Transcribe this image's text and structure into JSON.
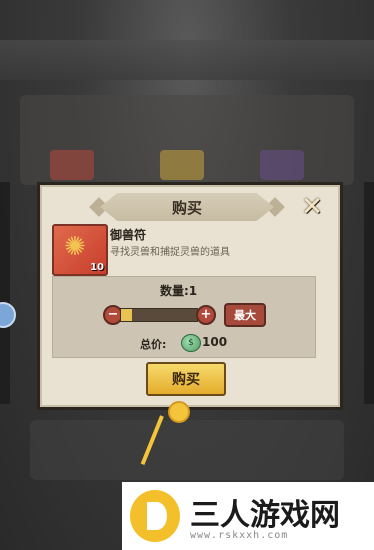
{
  "dialog": {
    "title": "购买",
    "close_icon": "crossed-swords-icon"
  },
  "item": {
    "name": "御兽符",
    "description": "寻找灵兽和捕捉灵兽的道具",
    "count": "10",
    "icon": "talisman-icon"
  },
  "quantity": {
    "label": "数量:1",
    "value": 1,
    "slider_fill_fraction": 0.15,
    "minus_label": "−",
    "plus_label": "+",
    "max_label": "最大"
  },
  "total": {
    "label": "总价:",
    "currency_icon": "spirit-coin-icon",
    "value": "100"
  },
  "buy_button": {
    "label": "购买"
  },
  "watermark": {
    "text": "三人游戏网",
    "url": "www.rskxxh.com"
  },
  "colors": {
    "dialog_bg": "#e9e2d2",
    "buy_button": "#f0c545",
    "accent_red": "#a64a3c"
  }
}
